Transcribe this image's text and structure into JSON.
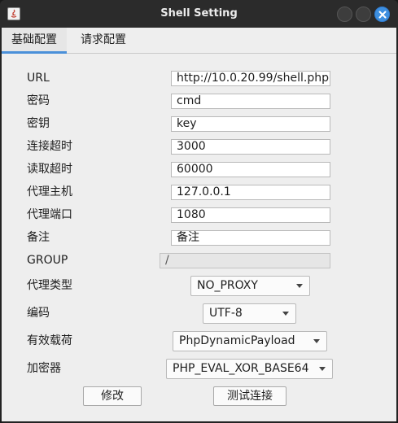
{
  "window": {
    "title": "Shell Setting"
  },
  "tabs": [
    {
      "label": "基础配置"
    },
    {
      "label": "请求配置"
    }
  ],
  "form": {
    "url": {
      "label": "URL",
      "value": "http://10.0.20.99/shell.php"
    },
    "password": {
      "label": "密码",
      "value": "cmd"
    },
    "secret_key": {
      "label": "密钥",
      "value": "key"
    },
    "connect_timeout": {
      "label": "连接超时",
      "value": "3000"
    },
    "read_timeout": {
      "label": "读取超时",
      "value": "60000"
    },
    "proxy_host": {
      "label": "代理主机",
      "value": "127.0.0.1"
    },
    "proxy_port": {
      "label": "代理端口",
      "value": "1080"
    },
    "remark": {
      "label": "备注",
      "value": "备注"
    },
    "group": {
      "label": "GROUP",
      "value": "/"
    },
    "proxy_type": {
      "label": "代理类型",
      "selected": "NO_PROXY"
    },
    "encoding": {
      "label": "编码",
      "selected": "UTF-8"
    },
    "payload": {
      "label": "有效载荷",
      "selected": "PhpDynamicPayload"
    },
    "cryption": {
      "label": "加密器",
      "selected": "PHP_EVAL_XOR_BASE64"
    }
  },
  "buttons": {
    "modify": "修改",
    "test_connection": "测试连接"
  },
  "colors": {
    "accent": "#4a90d9",
    "close_button": "#3d8fe0",
    "titlebar": "#2b2b2b",
    "panel": "#eeeeee"
  }
}
